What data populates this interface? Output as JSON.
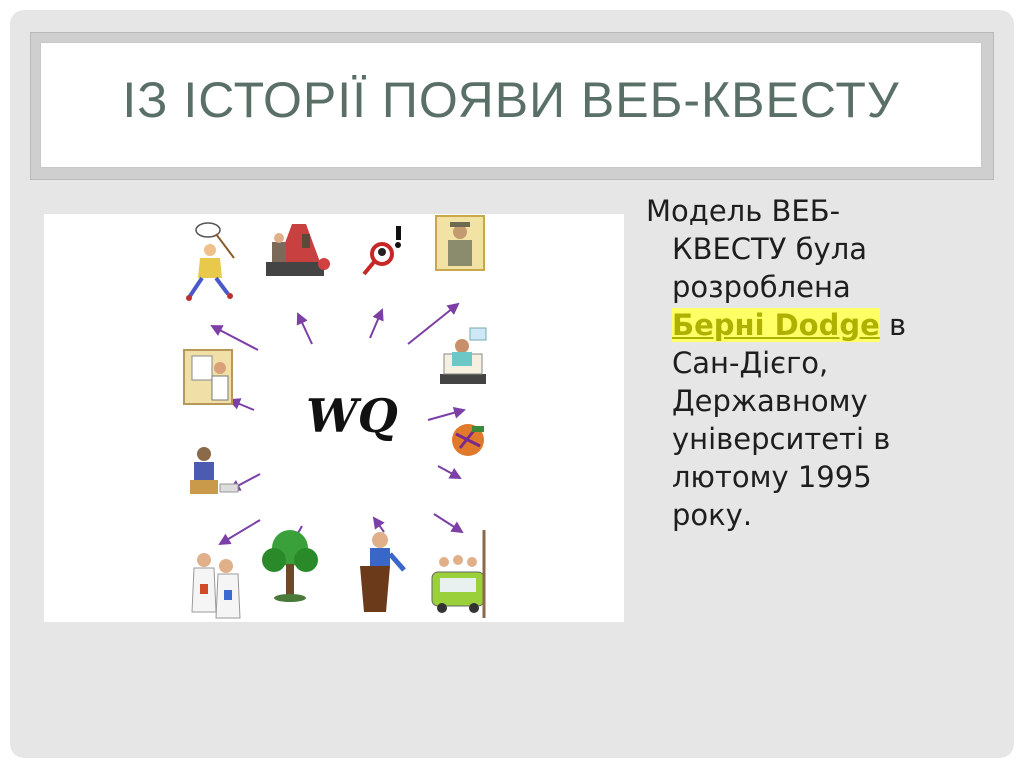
{
  "slide": {
    "title": "ІЗ ІСТОРІЇ ПОЯВИ ВЕБ-КВЕСТУ",
    "picture": {
      "label": "WQ",
      "icons": [
        "butterfly-net-person-icon",
        "theater-stage-icon",
        "detective-magnifier-icon",
        "reporter-portrait-icon",
        "painter-icon",
        "scientist-lab-icon",
        "reading-person-icon",
        "globe-pen-icon",
        "superhero-group-icon",
        "tree-icon",
        "speaker-podium-icon",
        "family-car-icon"
      ]
    },
    "body": {
      "line1": "Модель ВЕБ-",
      "line2": "КВЕСТУ була",
      "line3": "розроблена",
      "link_text": "Берні Dodge",
      "after_link": " в",
      "line5": "Сан-Дієго,",
      "line6": "Державному",
      "line7": "університеті в",
      "line8": "лютому 1995",
      "line9": "року."
    }
  }
}
